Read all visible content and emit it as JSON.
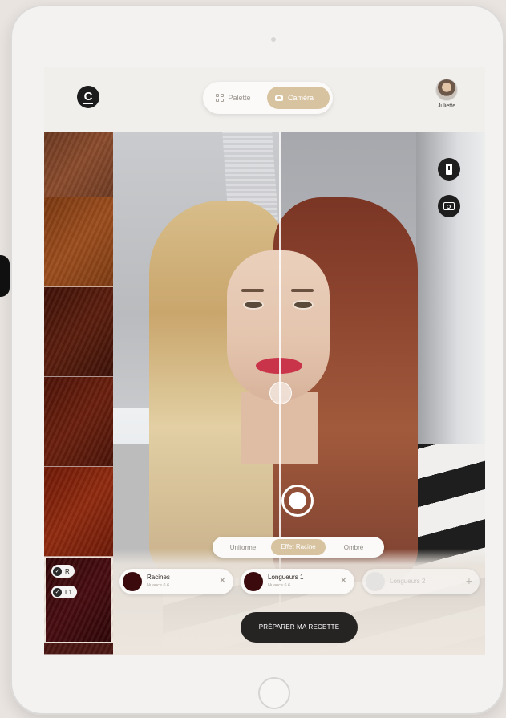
{
  "header": {
    "logo_letter": "C",
    "mode_tabs": [
      {
        "label": "Palette",
        "active": false
      },
      {
        "label": "Caméra",
        "active": true
      }
    ],
    "user": {
      "name": "Juliette"
    }
  },
  "swatches": {
    "colors": [
      "#7a4326",
      "#8e4317",
      "#4a1509",
      "#5a1709",
      "#7a1e0a",
      "#3a0709"
    ],
    "selected_chips": [
      "R",
      "L1"
    ]
  },
  "camera": {
    "effect_options": [
      {
        "label": "Uniforme",
        "active": false
      },
      {
        "label": "Effet Racine",
        "active": true
      },
      {
        "label": "Ombré",
        "active": false
      }
    ],
    "icons": [
      "alert-icon",
      "flip-camera-icon"
    ]
  },
  "formula": {
    "slots": [
      {
        "title": "Racines",
        "subtitle": "Nuance 6.6",
        "color": "#3a0a0c",
        "filled": true
      },
      {
        "title": "Longueurs 1",
        "subtitle": "Nuance 6.6",
        "color": "#3a0a0c",
        "filled": true
      },
      {
        "title": "Longueurs 2",
        "subtitle": "",
        "color": "#e5e3e1",
        "filled": false
      }
    ],
    "cta_label": "PRÉPARER MA RECETTE"
  },
  "colors": {
    "accent": "#d8c3a0",
    "dark": "#262323"
  }
}
